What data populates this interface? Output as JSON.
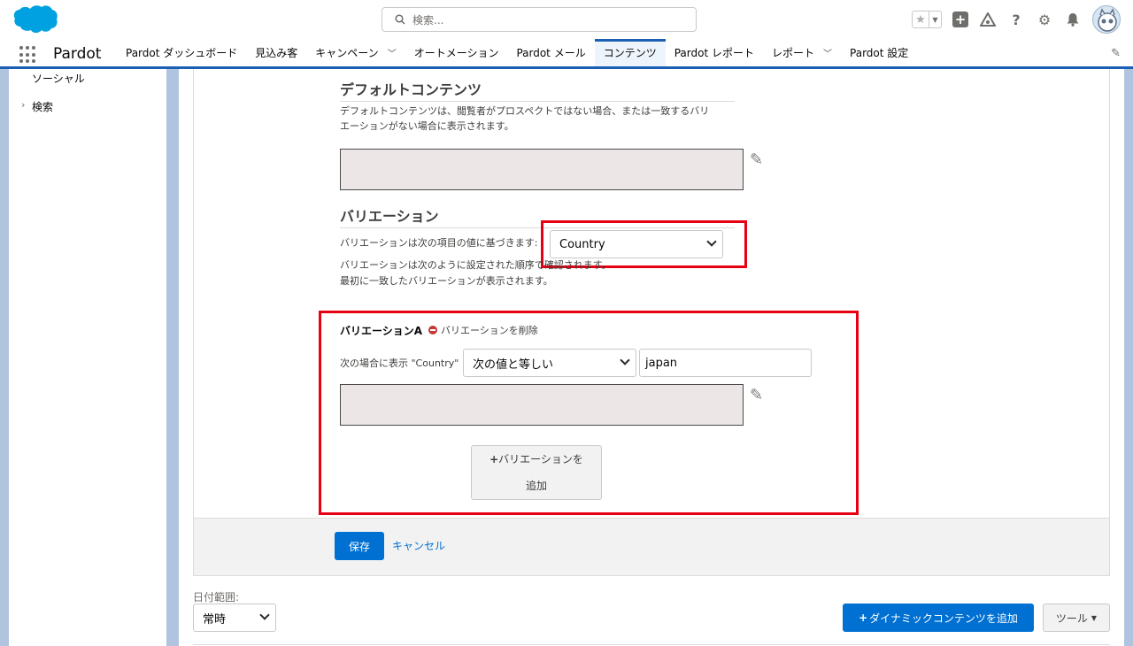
{
  "header": {
    "search_placeholder": "検索...",
    "icons": [
      "favorites-star-icon",
      "favorites-list-icon",
      "global-add-icon",
      "trailhead-icon",
      "help-icon",
      "setup-gear-icon",
      "notifications-bell-icon",
      "user-avatar"
    ]
  },
  "nav": {
    "app_name": "Pardot",
    "tabs": [
      {
        "label": "Pardot ダッシュボード",
        "has_menu": false,
        "active": false
      },
      {
        "label": "見込み客",
        "has_menu": false,
        "active": false
      },
      {
        "label": "キャンペーン",
        "has_menu": true,
        "active": false
      },
      {
        "label": "オートメーション",
        "has_menu": false,
        "active": false
      },
      {
        "label": "Pardot メール",
        "has_menu": false,
        "active": false
      },
      {
        "label": "コンテンツ",
        "has_menu": false,
        "active": true
      },
      {
        "label": "Pardot レポート",
        "has_menu": false,
        "active": false
      },
      {
        "label": "レポート",
        "has_menu": true,
        "active": false
      },
      {
        "label": "Pardot 設定",
        "has_menu": false,
        "active": false
      }
    ]
  },
  "sidebar": {
    "items": [
      {
        "label": "ソーシャル"
      },
      {
        "label": "検索"
      }
    ]
  },
  "default_content": {
    "title": "デフォルトコンテンツ",
    "description_line1": "デフォルトコンテンツは、閲覧者がプロスペクトではない場合、または一致するバリ",
    "description_line2": "エーションがない場合に表示されます。"
  },
  "variations": {
    "title": "バリエーション",
    "based_on_label": "バリエーションは次の項目の値に基づきます:",
    "based_on_value": "Country",
    "order_line1": "バリエーションは次のように設定された順序で確認されます。",
    "order_line2": "最初に一致したバリエーションが表示されます。"
  },
  "variation_a": {
    "title": "バリエーションA",
    "delete_label": "バリエーションを削除",
    "condition_label": "次の場合に表示 \"Country\"",
    "operator": "次の値と等しい",
    "value": "japan",
    "add_button_line1": "バリエーションを",
    "add_button_line2": "追加"
  },
  "form_actions": {
    "save": "保存",
    "cancel": "キャンセル"
  },
  "bottom": {
    "date_range_label": "日付範囲:",
    "date_range_value": "常時",
    "add_dynamic_content": "ダイナミックコンテンツを追加",
    "tools": "ツール"
  },
  "colors": {
    "brand_blue": "#0070d2",
    "highlight_red": "#e60012",
    "nav_active": "#1b5fb4"
  }
}
